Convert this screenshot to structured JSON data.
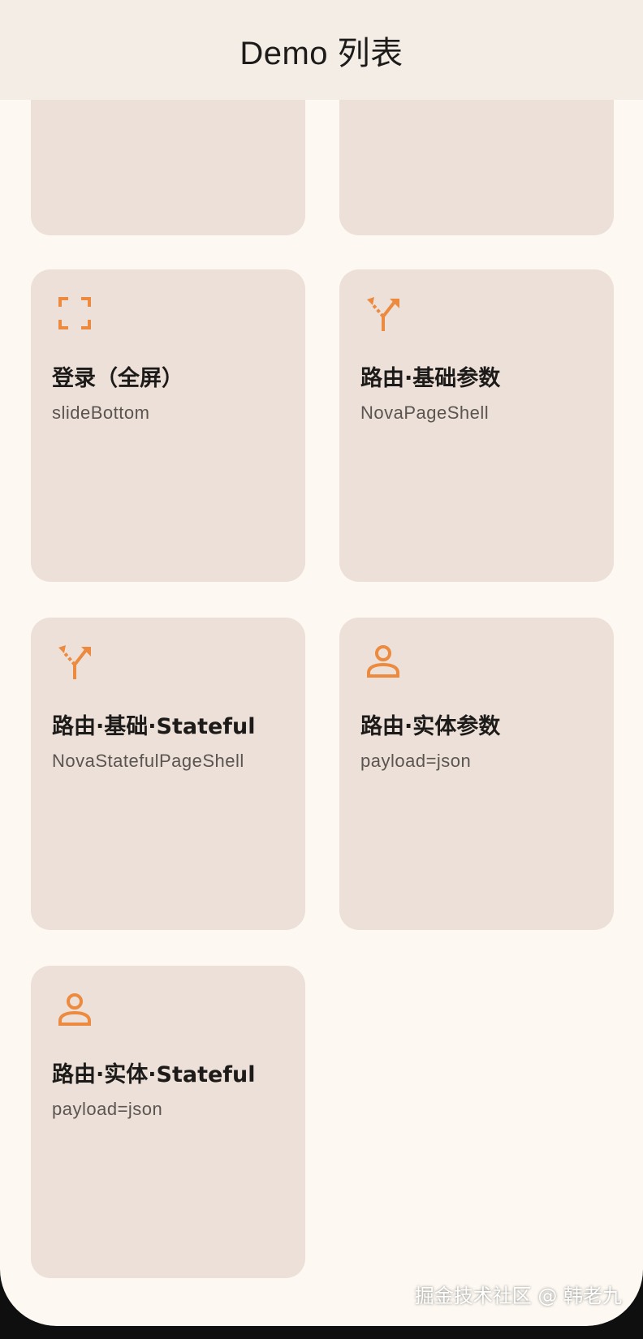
{
  "app_bar": {
    "title": "Demo 列表"
  },
  "cards": [
    {
      "icon": "",
      "title": "",
      "subtitle": ""
    },
    {
      "icon": "",
      "title": "",
      "subtitle": ""
    },
    {
      "icon": "fullscreen-icon",
      "title": "登录（全屏）",
      "subtitle": "slideBottom"
    },
    {
      "icon": "fork-icon",
      "title": "路由·基础参数",
      "subtitle": "NovaPageShell"
    },
    {
      "icon": "fork-icon",
      "title": "路由·基础·Stateful",
      "subtitle": "NovaStatefulPageShell"
    },
    {
      "icon": "person-icon",
      "title": "路由·实体参数",
      "subtitle": "payload=json"
    },
    {
      "icon": "person-icon",
      "title": "路由·实体·Stateful",
      "subtitle": "payload=json"
    }
  ],
  "watermark": "掘金技术社区 @ 韩老九",
  "colors": {
    "accent": "#ec8a3f",
    "card_bg": "#ede0d8",
    "page_bg": "#fdf9f2",
    "app_bar_bg": "#f3ede6"
  }
}
